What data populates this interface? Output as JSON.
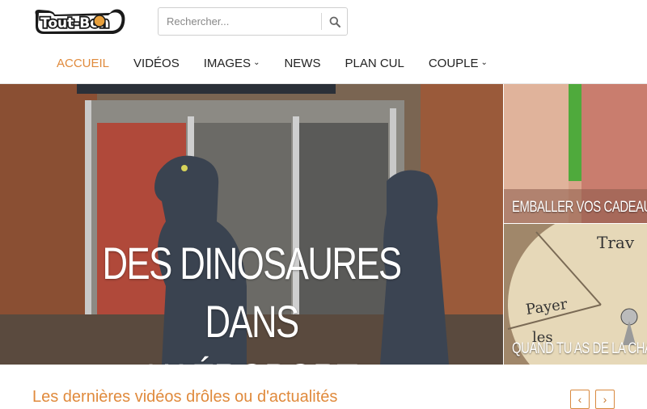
{
  "logo": {
    "text": "Tout-Bon"
  },
  "search": {
    "placeholder": "Rechercher...",
    "icon": "search-icon"
  },
  "nav": {
    "items": [
      {
        "label": "ACCUEIL",
        "active": true,
        "dropdown": false
      },
      {
        "label": "VIDÉOS",
        "active": false,
        "dropdown": false
      },
      {
        "label": "IMAGES",
        "active": false,
        "dropdown": true
      },
      {
        "label": "NEWS",
        "active": false,
        "dropdown": false
      },
      {
        "label": "PLAN CUL",
        "active": false,
        "dropdown": false
      },
      {
        "label": "COUPLE",
        "active": false,
        "dropdown": true
      }
    ]
  },
  "featured": {
    "main": {
      "title_line1": "DES DINOSAURES DANS",
      "title_line2": "L’AÉROPORT"
    },
    "side": [
      {
        "caption": "EMBALLER VOS CADEAUX I"
      },
      {
        "caption": "QUAND TU AS DE LA CHAN"
      }
    ]
  },
  "latest": {
    "title": "Les dernières vidéos drôles ou d'actualités"
  },
  "colors": {
    "accent": "#e08a3c"
  }
}
